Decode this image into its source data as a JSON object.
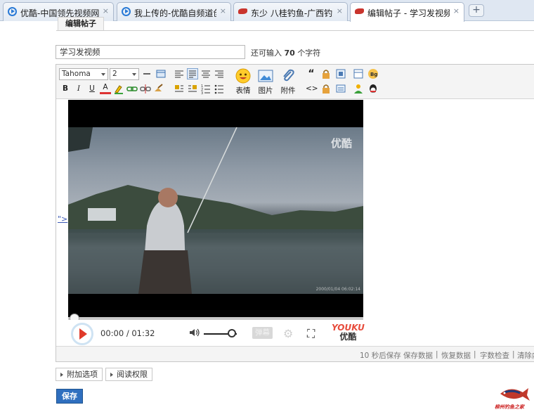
{
  "browser": {
    "tabs": [
      {
        "title": "优酷-中国领先视频网站,",
        "icon": "youku-play-icon",
        "active": false
      },
      {
        "title": "我上传的-优酷自频道创作",
        "icon": "youku-play-icon",
        "active": false
      },
      {
        "title": "东少 八桂钓鱼-广西钓鱼",
        "icon": "fish-icon",
        "active": false
      },
      {
        "title": "编辑帖子 - 学习发视频 -",
        "icon": "fish-icon",
        "active": true
      }
    ],
    "close_glyph": "×",
    "new_tab_glyph": "+"
  },
  "form": {
    "section_tab": "编辑帖子",
    "title_value": "学习发视频",
    "char_hint_prefix": "还可输入",
    "char_hint_count": "70",
    "char_hint_suffix": "个字符"
  },
  "toolbar": {
    "font_family": "Tahoma",
    "font_size": "2",
    "emoji_label": "表情",
    "image_label": "图片",
    "attachment_label": "附件",
    "bold": "B",
    "italic": "I",
    "underline": "U",
    "font_color": "A",
    "quote": "“",
    "code": "<>"
  },
  "content": {
    "link_text": "\">"
  },
  "player": {
    "watermark": "优酷",
    "timestamp": "2000/01/04 06:02:14",
    "current_time": "00:00",
    "separator": "/",
    "duration": "01:32",
    "danmaku_label": "弹幕",
    "brand_top": "YOUKU",
    "brand_bottom": "优酷",
    "volume_level": 0.85
  },
  "statusbar": {
    "autosave": "10 秒后保存 保存数据",
    "restore": "恢复数据",
    "wordcheck": "字数检查",
    "clear": "清除内容",
    "divider": "|"
  },
  "actions": {
    "extra_options": "附加选项",
    "read_permission": "阅读权限",
    "save": "保存"
  },
  "logo": {
    "text": "柳州钓鱼之家"
  },
  "colors": {
    "accent": "#2f6fbf",
    "play_red": "#e03a2a",
    "youku_red": "#e74c3c"
  }
}
